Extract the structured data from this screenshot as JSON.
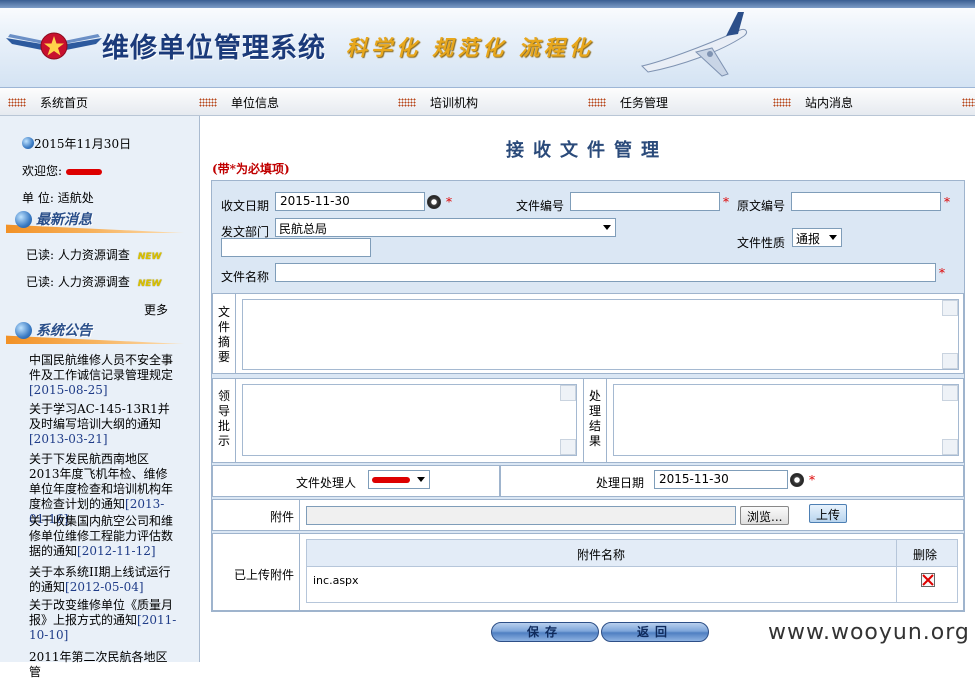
{
  "app": {
    "title": "维修单位管理系统",
    "slogan": "科学化  规范化  流程化"
  },
  "nav": {
    "items": [
      "系统首页",
      "单位信息",
      "培训机构",
      "任务管理",
      "站内消息"
    ]
  },
  "sidebar": {
    "date": "2015年11月30日",
    "welcome_label": "欢迎您:",
    "unit_label": "单  位:",
    "unit_value": "适航处",
    "latest_title": "最新消息",
    "news": [
      {
        "text": "已读: 人力资源调查",
        "tag": "NEW"
      },
      {
        "text": "已读: 人力资源调查",
        "tag": "NEW"
      }
    ],
    "more": "更多",
    "notice_title": "系统公告",
    "notices": [
      {
        "title": "中国民航维修人员不安全事件及工作诚信记录管理规定",
        "date": "[2015-08-25]"
      },
      {
        "title": "关于学习AC-145-13R1并及时编写培训大纲的通知",
        "date": "[2013-03-21]"
      },
      {
        "title": "关于下发民航西南地区2013年度飞机年检、维修单位年度检查和培训机构年度检查计划的通知",
        "date": "[2013-01-16]"
      },
      {
        "title": "关于收集国内航空公司和维修单位维修工程能力评估数据的通知",
        "date": "[2012-11-12]"
      },
      {
        "title": "关于本系统II期上线试运行的通知",
        "date": "[2012-05-04]"
      },
      {
        "title": "关于改变维修单位《质量月报》上报方式的通知",
        "date": "[2011-10-10]"
      },
      {
        "title": "2011年第二次民航各地区管",
        "date": ""
      }
    ]
  },
  "form": {
    "title": "接收文件管理",
    "required_note": "(带*为必填项)",
    "receive_date_label": "收文日期",
    "receive_date_value": "2015-11-30",
    "doc_no_label": "文件编号",
    "doc_no_value": "",
    "orig_no_label": "原文编号",
    "orig_no_value": "",
    "dept_label": "发文部门",
    "dept_value": "民航总局",
    "doc_nature_label": "文件性质",
    "doc_nature_value": "通报",
    "doc_name_label": "文件名称",
    "doc_name_value": "",
    "summary_label": "文件摘要",
    "leader_label": "领导批示",
    "result_label": "处理结果",
    "handler_label": "文件处理人",
    "handle_date_label": "处理日期",
    "handle_date_value": "2015-11-30",
    "attachment_label": "附件",
    "browse_label": "浏览...",
    "upload_label": "上传",
    "uploaded_label": "已上传附件",
    "table_headers": [
      "附件名称",
      "删除"
    ],
    "attachments": [
      {
        "name": "inc.aspx"
      }
    ],
    "required_mark": "*",
    "save_label": "保存",
    "back_label": "返回"
  },
  "watermark": "www.wooyun.org"
}
